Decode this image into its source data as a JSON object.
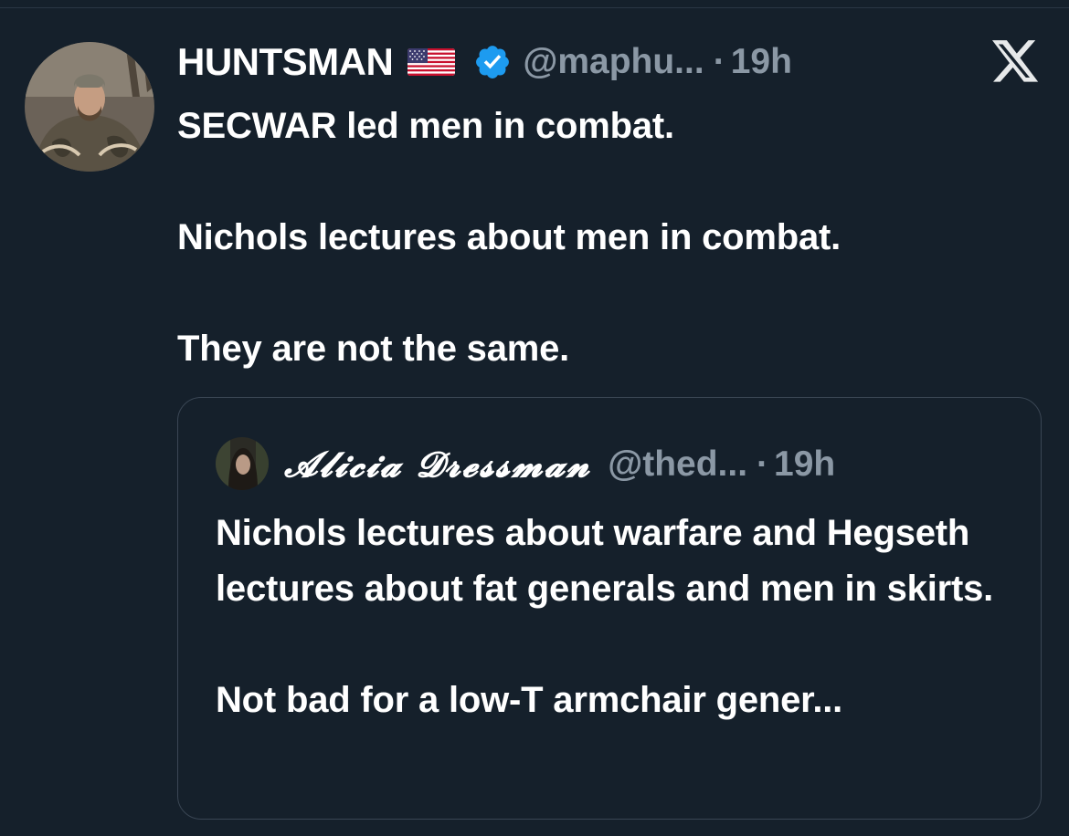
{
  "post": {
    "author_name": "HUNTSMAN",
    "author_handle": "@maphu...",
    "separator": "·",
    "time": "19h",
    "paragraphs": [
      "SECWAR led men in combat.",
      "Nichols lectures about men in combat.",
      "They are not the same."
    ],
    "flag_icon": "us-flag-icon",
    "verified_icon": "verified-badge-icon",
    "verified_color": "#1d9bf0"
  },
  "quoted_post": {
    "author_name": "𝓐𝓵𝓲𝓬𝓲𝓪 𝓓𝓻𝓮𝓼𝓼𝓶𝓪𝓷",
    "author_handle": "@thed...",
    "separator": "·",
    "time": "19h",
    "paragraphs": [
      "Nichols lectures about warfare and Hegseth lectures about fat generals and men in skirts.",
      "Not bad for a low-T armchair gener..."
    ]
  },
  "brand": {
    "logo_icon": "x-logo-icon"
  },
  "colors": {
    "background": "#15202b",
    "text": "#ffffff",
    "secondary_text": "#8b98a5",
    "border": "#3a4654"
  }
}
